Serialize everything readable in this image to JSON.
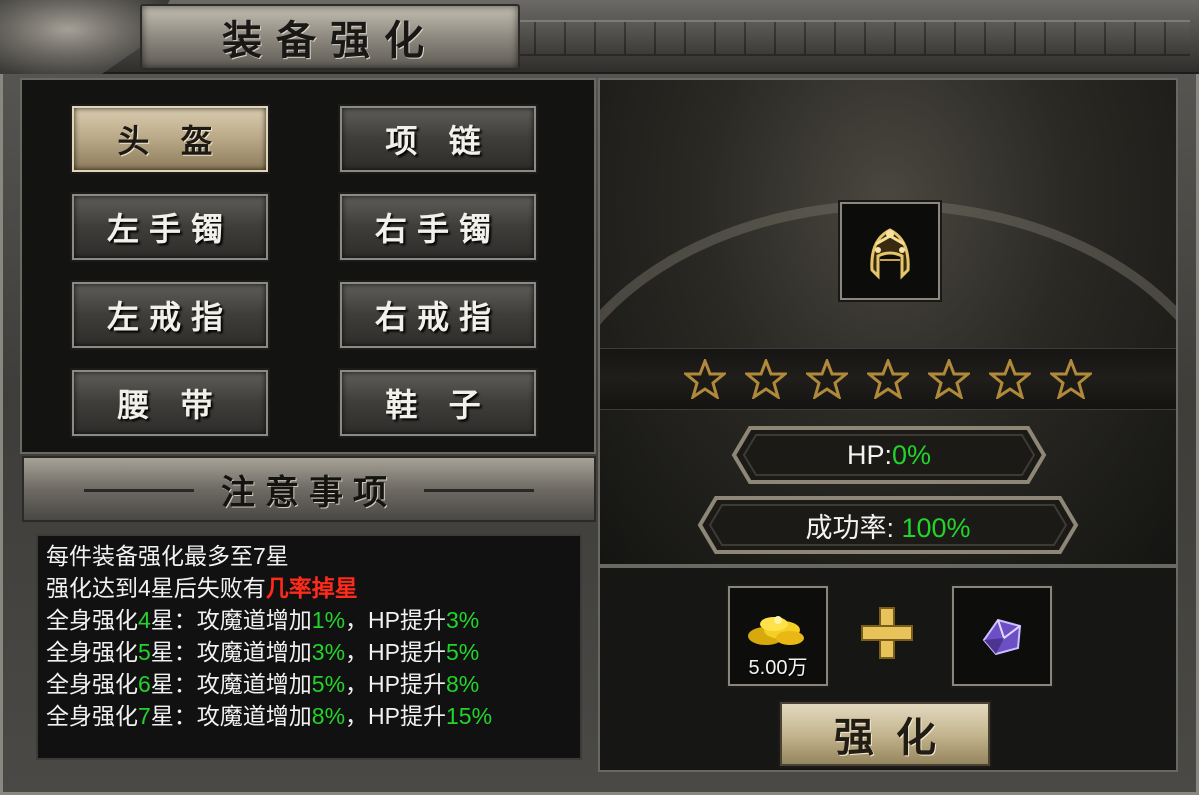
{
  "window": {
    "title": "装备强化"
  },
  "slots": [
    {
      "label": "头 盔",
      "active": true
    },
    {
      "label": "项 链",
      "active": false
    },
    {
      "label": "左手镯",
      "active": false
    },
    {
      "label": "右手镯",
      "active": false
    },
    {
      "label": "左戒指",
      "active": false
    },
    {
      "label": "右戒指",
      "active": false
    },
    {
      "label": "腰 带",
      "active": false
    },
    {
      "label": "鞋 子",
      "active": false
    }
  ],
  "notes": {
    "title": "注意事项",
    "line1": "每件装备强化最多至7星",
    "line2_prefix": "强化达到4星后失败有",
    "line2_highlight": "几率掉星",
    "rows": [
      {
        "p1": "全身强化",
        "star": "4",
        "p2": "星：攻魔道增加",
        "atk": "1%",
        "p3": "，HP提升",
        "hp": "3%"
      },
      {
        "p1": "全身强化",
        "star": "5",
        "p2": "星：攻魔道增加",
        "atk": "3%",
        "p3": "，HP提升",
        "hp": "5%"
      },
      {
        "p1": "全身强化",
        "star": "6",
        "p2": "星：攻魔道增加",
        "atk": "5%",
        "p3": "，HP提升",
        "hp": "8%"
      },
      {
        "p1": "全身强化",
        "star": "7",
        "p2": "星：攻魔道增加",
        "atk": "8%",
        "p3": "，HP提升",
        "hp": "15%"
      }
    ]
  },
  "item": {
    "icon": "helmet-icon",
    "stars_total": 7,
    "stars_filled": 0
  },
  "stats": {
    "hp_label": "HP:",
    "hp_value": "0%",
    "rate_label": "成功率: ",
    "rate_value": "100%"
  },
  "cost": {
    "gold_icon": "gold-coins-icon",
    "gold_amount": "5.00万",
    "material_icon": "purple-gem-icon"
  },
  "actions": {
    "enhance_label": "强化"
  },
  "colors": {
    "highlight_green": "#22d42a",
    "warning_red": "#ff2a1a",
    "star_gold": "#b08a3a"
  }
}
